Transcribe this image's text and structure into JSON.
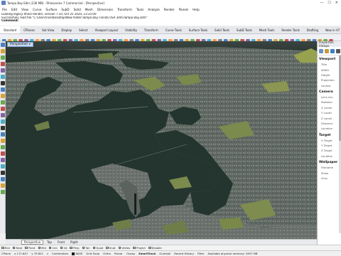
{
  "titlebar": {
    "title": "Tampa Bay Edin (236 MB) - Rhinoceros 7 Commercial - [Perspective]",
    "min": "—",
    "max": "☐",
    "close": "✕"
  },
  "menu": [
    "File",
    "Edit",
    "View",
    "Curve",
    "Surface",
    "SubD",
    "Solid",
    "Mesh",
    "Dimension",
    "Transform",
    "Tools",
    "Analyze",
    "Render",
    "Panels",
    "Help"
  ],
  "command_history": [
    "Loading legacy Rhino Render, version 7.10, Oct 25 2020, 23:25:00",
    "Successfully read file \"C:\\Users\\rsiel\\Desktop\\New folder\\Tampa Bay Florida USA 3dm\\Tampa Bay.3dm\"",
    "Command:"
  ],
  "ribbon_tabs": [
    "Standard",
    "CPlanes",
    "Set View",
    "Display",
    "Select",
    "Viewport Layout",
    "Visibility",
    "Transform",
    "Curve Tools",
    "Surface Tools",
    "Solid Tools",
    "SubD Tools",
    "Mesh Tools",
    "Render Tools",
    "Drafting",
    "New in V7"
  ],
  "ribbon_active": "Standard",
  "viewport": {
    "label": "Perspective"
  },
  "view_tabs": [
    "Perspective",
    "Top",
    "Front",
    "Right"
  ],
  "view_tabs_active": "Perspective",
  "osnaps": [
    "End",
    "Near",
    "Point",
    "Mid",
    "Cen",
    "Int",
    "Perp",
    "Tan",
    "Quad",
    "Knot",
    "Vertex",
    "Project",
    "Disable"
  ],
  "status": {
    "cplane": "CPlane",
    "x": "x 171.647",
    "y": "y 79.821",
    "z": "z",
    "units": "Centimeters",
    "layer": "BASE",
    "toggles": [
      "Grid Snap",
      "Ortho",
      "Planar",
      "Osnap",
      "SmartTrack",
      "Gumball",
      "Record History",
      "Filter"
    ],
    "smarttrack_bold": "SmartTrack",
    "memory": "Available physical memory: 3497 MB"
  },
  "properties_panel": {
    "header": "Properties: Viewpo",
    "sections": [
      {
        "title": "Viewport",
        "rows": [
          "Title",
          "Width",
          "Height",
          "Projection",
          "Locked"
        ]
      },
      {
        "title": "Camera",
        "rows": [
          "Lens Len",
          "Rotation",
          "X Locati",
          "Y Locati",
          "Z Locati",
          "Distance",
          "Location"
        ]
      },
      {
        "title": "Target",
        "rows": [
          "X Target",
          "Y Target",
          "Z Target",
          "Location"
        ]
      },
      {
        "title": "Wallpaper",
        "rows": [
          "Filename",
          "Show",
          "Gray"
        ]
      }
    ]
  },
  "colors": {
    "water": "#24342f",
    "land": "#5d6660",
    "vegetation": "#7c8a4f",
    "viewport_label_bg": "#c6d8ef"
  }
}
